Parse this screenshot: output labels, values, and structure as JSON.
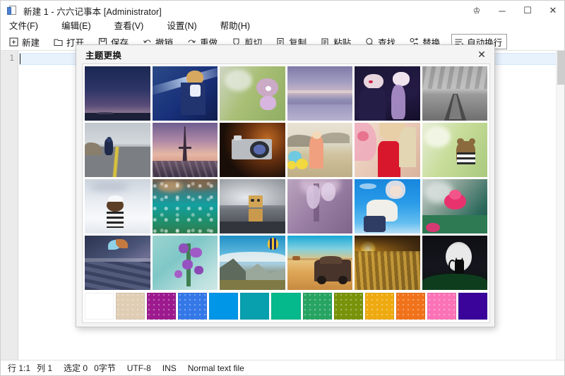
{
  "window": {
    "title": "新建 1 - 六六记事本 [Administrator]",
    "icon": "notepad-document-icon",
    "controls": {
      "gift": "♔",
      "minimize": "─",
      "maximize": "☐",
      "close": "✕"
    }
  },
  "menubar": {
    "items": [
      {
        "label": "文件(F)",
        "name": "menu-file"
      },
      {
        "label": "编辑(E)",
        "name": "menu-edit"
      },
      {
        "label": "查看(V)",
        "name": "menu-view"
      },
      {
        "label": "设置(N)",
        "name": "menu-settings"
      },
      {
        "label": "帮助(H)",
        "name": "menu-help"
      }
    ]
  },
  "toolbar": {
    "items": [
      {
        "label": "新建",
        "icon": "new-file-icon",
        "active": false
      },
      {
        "label": "打开",
        "icon": "open-folder-icon",
        "active": false
      },
      {
        "label": "保存",
        "icon": "save-disk-icon",
        "active": false
      },
      {
        "label": "撤销",
        "icon": "undo-arrow-icon",
        "active": false
      },
      {
        "label": "重做",
        "icon": "redo-arrow-icon",
        "active": false
      },
      {
        "label": "剪切",
        "icon": "scissors-icon",
        "active": false
      },
      {
        "label": "复制",
        "icon": "copy-icon",
        "active": false
      },
      {
        "label": "粘贴",
        "icon": "paste-icon",
        "active": false
      },
      {
        "label": "查找",
        "icon": "search-icon",
        "active": false
      },
      {
        "label": "替换",
        "icon": "replace-icon",
        "active": false
      },
      {
        "label": "自动换行",
        "icon": "word-wrap-icon",
        "active": true
      }
    ]
  },
  "editor": {
    "line_numbers": [
      "1"
    ],
    "content": ""
  },
  "statusbar": {
    "row_col": "行 1:1",
    "col": "列 1",
    "selected": "选定 0",
    "bytes": "0字节",
    "encoding": "UTF-8",
    "insert_mode": "INS",
    "file_type": "Normal text file"
  },
  "dialog": {
    "title": "主题更换",
    "close_label": "✕",
    "thumbnails": [
      {
        "name": "dusk-sky-horizon",
        "alt": "暮色天空"
      },
      {
        "name": "anime-sword-knight",
        "alt": "动漫骑士"
      },
      {
        "name": "lavender-blossom-green",
        "alt": "紫色花朵"
      },
      {
        "name": "purple-seashore",
        "alt": "紫色海滩"
      },
      {
        "name": "dark-anime-duo",
        "alt": "暗色动漫双人"
      },
      {
        "name": "grayscale-pier",
        "alt": "黑白栈桥"
      },
      {
        "name": "motorcycle-highway",
        "alt": "公路摩托"
      },
      {
        "name": "eiffel-tower-sunset",
        "alt": "埃菲尔铁塔"
      },
      {
        "name": "vintage-camera",
        "alt": "复古相机"
      },
      {
        "name": "girl-with-balloons",
        "alt": "气球女孩"
      },
      {
        "name": "woman-red-dress-flowers",
        "alt": "红裙女子"
      },
      {
        "name": "teddy-bear-garden",
        "alt": "花园玩偶熊"
      },
      {
        "name": "figurine-on-snow",
        "alt": "雪地玩偶"
      },
      {
        "name": "teal-water-bubbles",
        "alt": "青绿水泡"
      },
      {
        "name": "danbo-cardboard-robot",
        "alt": "阿楞纸箱人"
      },
      {
        "name": "wisteria-purple",
        "alt": "紫藤花"
      },
      {
        "name": "anime-girl-blue-sky",
        "alt": "蓝天动漫少女"
      },
      {
        "name": "pink-flower-greens",
        "alt": "粉色花朵"
      },
      {
        "name": "butterfly-on-metal",
        "alt": "金属上的蝴蝶"
      },
      {
        "name": "purple-flowers-teal",
        "alt": "青底紫花"
      },
      {
        "name": "hot-air-balloon-mountain",
        "alt": "山谷热气球"
      },
      {
        "name": "rusty-car-desert",
        "alt": "沙漠旧车"
      },
      {
        "name": "golden-wheat-sunset",
        "alt": "金色麦田"
      },
      {
        "name": "black-cat-moon",
        "alt": "月下黑猫"
      }
    ],
    "palette": [
      {
        "name": "swatch-white",
        "color": "#ffffff",
        "patterned": false
      },
      {
        "name": "swatch-tan",
        "color": "#dfcdb4",
        "patterned": true
      },
      {
        "name": "swatch-magenta",
        "color": "#9c1a8e",
        "patterned": true
      },
      {
        "name": "swatch-blue",
        "color": "#3478e8",
        "patterned": true
      },
      {
        "name": "swatch-azure",
        "color": "#0096e8",
        "patterned": false
      },
      {
        "name": "swatch-teal",
        "color": "#08a0ae",
        "patterned": false
      },
      {
        "name": "swatch-emerald",
        "color": "#05b98c",
        "patterned": false
      },
      {
        "name": "swatch-green",
        "color": "#27a462",
        "patterned": true
      },
      {
        "name": "swatch-olive",
        "color": "#78930a",
        "patterned": true
      },
      {
        "name": "swatch-amber",
        "color": "#eeaa10",
        "patterned": true
      },
      {
        "name": "swatch-orange",
        "color": "#f0721a",
        "patterned": true
      },
      {
        "name": "swatch-pink",
        "color": "#fb72b6",
        "patterned": true
      },
      {
        "name": "swatch-indigo",
        "color": "#3a049b",
        "patterned": false
      }
    ]
  }
}
